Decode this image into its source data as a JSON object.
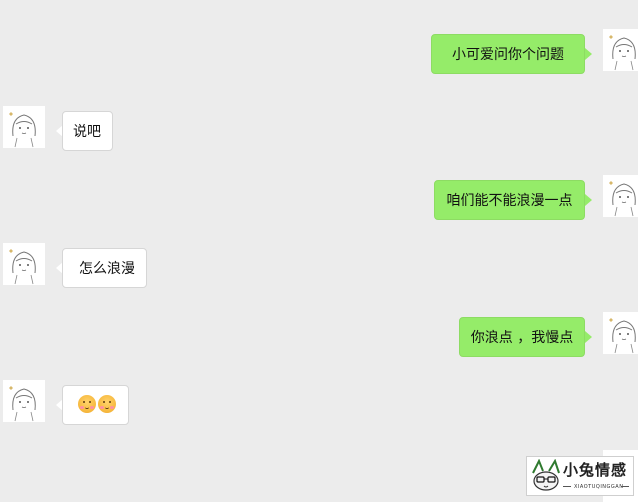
{
  "messages": [
    {
      "side": "sent",
      "text": "小可爱问你个问题"
    },
    {
      "side": "received",
      "text": "说吧"
    },
    {
      "side": "sent",
      "text": "咱们能不能浪漫一点"
    },
    {
      "side": "received",
      "text": "怎么浪漫"
    },
    {
      "side": "sent",
      "text": "你浪点 ，我慢点"
    },
    {
      "side": "received",
      "text": ""
    }
  ],
  "watermark": {
    "title": "小兔情感",
    "subtitle": "XIAOTUQINGGAN"
  },
  "icons": {
    "avatar": "girl-sketch-avatar-icon",
    "emoji": "blushing-smile-emoji-icon",
    "logo": "rabbit-logo-icon"
  },
  "colors": {
    "background": "#ececec",
    "sent_bubble": "#95ec69",
    "received_bubble": "#ffffff"
  }
}
